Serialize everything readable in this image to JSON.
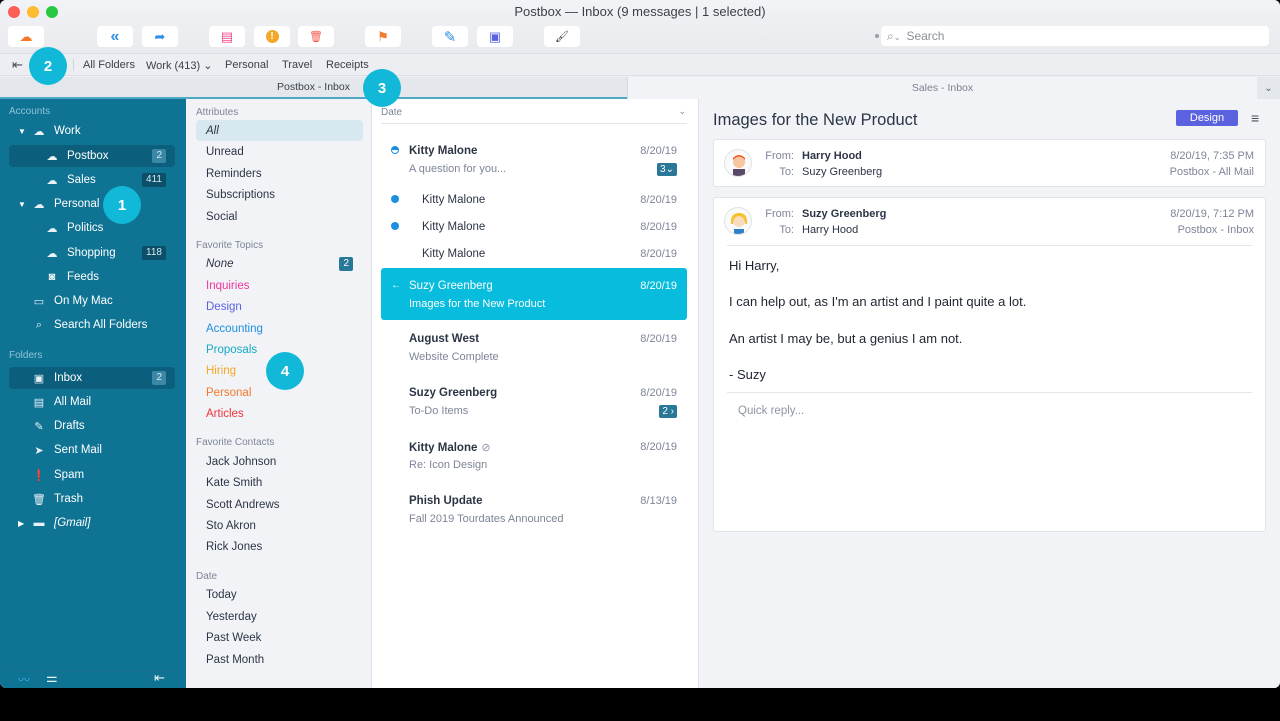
{
  "window": {
    "title": "Postbox — Inbox (9 messages | 1 selected)"
  },
  "toolbar": {
    "buttons": [
      {
        "name": "get-mail",
        "icon": "cloud-upload-icon",
        "glyph": "☁",
        "color": "#f27a2a"
      },
      {
        "name": "reply-all",
        "icon": "reply-all-icon",
        "glyph": "«",
        "color": "#2e8fe4"
      },
      {
        "name": "forward",
        "icon": "forward-icon",
        "glyph": "➦",
        "color": "#2e8fe4"
      },
      {
        "name": "archive",
        "icon": "archive-icon",
        "glyph": "▤",
        "color": "#f0498d"
      },
      {
        "name": "junk",
        "icon": "alert-icon",
        "glyph": "!",
        "color": "#f3a82a"
      },
      {
        "name": "delete",
        "icon": "trash-icon",
        "glyph": "🗑",
        "color": "#f25a4a"
      },
      {
        "name": "flag",
        "icon": "flag-icon",
        "glyph": "⚑",
        "color": "#f27a2a"
      },
      {
        "name": "compose",
        "icon": "pencil-icon",
        "glyph": "✎",
        "color": "#2e8fe4"
      },
      {
        "name": "address-book",
        "icon": "contacts-icon",
        "glyph": "▣",
        "color": "#5b62e0"
      },
      {
        "name": "themes",
        "icon": "brush-icon",
        "glyph": "🖌",
        "color": "#3b3f47"
      }
    ],
    "search": {
      "placeholder": "Search",
      "value": "",
      "icon": "search-icon"
    }
  },
  "favorites_bar": {
    "items": [
      "All Folders",
      "Work (413)",
      "Personal",
      "Travel",
      "Receipts"
    ],
    "dropdown_glyph": "⌄"
  },
  "tabs": [
    {
      "label": "Postbox - Inbox",
      "active": true
    },
    {
      "label": "Sales - Inbox",
      "active": false
    }
  ],
  "sidebar": {
    "accounts_label": "Accounts",
    "accounts": [
      {
        "label": "Work",
        "icon": "cloud-icon",
        "expanded": true,
        "level": 0
      },
      {
        "label": "Postbox",
        "icon": "cloud-icon",
        "badge": "2",
        "selected": true,
        "level": 1
      },
      {
        "label": "Sales",
        "icon": "cloud-icon",
        "badge": "411",
        "level": 1
      },
      {
        "label": "Personal",
        "icon": "cloud-icon",
        "expanded": true,
        "level": 0
      },
      {
        "label": "Politics",
        "icon": "cloud-icon",
        "level": 1
      },
      {
        "label": "Shopping",
        "icon": "cloud-icon",
        "badge": "118",
        "level": 1
      },
      {
        "label": "Feeds",
        "icon": "rss-icon",
        "level": 1
      },
      {
        "label": "On My Mac",
        "icon": "monitor-icon",
        "level": 0
      },
      {
        "label": "Search All Folders",
        "icon": "search-icon",
        "level": 0
      }
    ],
    "folders_label": "Folders",
    "folders": [
      {
        "label": "Inbox",
        "icon": "inbox-icon",
        "badge": "2",
        "selected": true
      },
      {
        "label": "All Mail",
        "icon": "archive-icon"
      },
      {
        "label": "Drafts",
        "icon": "pencil-icon"
      },
      {
        "label": "Sent Mail",
        "icon": "send-icon"
      },
      {
        "label": "Spam",
        "icon": "alert-icon"
      },
      {
        "label": "Trash",
        "icon": "trash-icon"
      },
      {
        "label": "[Gmail]",
        "icon": "folder-icon",
        "collapsed": true
      }
    ]
  },
  "attributes": {
    "attributes_label": "Attributes",
    "attributes": [
      "All",
      "Unread",
      "Reminders",
      "Subscriptions",
      "Social"
    ],
    "topics_label": "Favorite Topics",
    "topics": [
      {
        "label": "None",
        "badge": "2",
        "color": "#2c3545"
      },
      {
        "label": "Inquiries",
        "color": "#f0359a"
      },
      {
        "label": "Design",
        "color": "#5b62e0"
      },
      {
        "label": "Accounting",
        "color": "#1d8fe0"
      },
      {
        "label": "Proposals",
        "color": "#15a9c4"
      },
      {
        "label": "Hiring",
        "color": "#f6a623"
      },
      {
        "label": "Personal",
        "color": "#f5782a"
      },
      {
        "label": "Articles",
        "color": "#f2353a"
      }
    ],
    "contacts_label": "Favorite Contacts",
    "contacts": [
      "Jack Johnson",
      "Kate Smith",
      "Scott Andrews",
      "Sto Akron",
      "Rick Jones"
    ],
    "date_label": "Date",
    "dates": [
      "Today",
      "Yesterday",
      "Past Week",
      "Past Month"
    ]
  },
  "message_list": {
    "sort_label": "Date",
    "messages": [
      {
        "from": "Kitty Malone",
        "subject": "A question for you...",
        "date": "8/20/19",
        "status": "partially-unread",
        "thread_count": "3⌄"
      },
      {
        "from": "Kitty Malone",
        "date": "8/20/19",
        "status": "unread",
        "child": true
      },
      {
        "from": "Kitty Malone",
        "date": "8/20/19",
        "status": "unread",
        "child": true
      },
      {
        "from": "Kitty Malone",
        "date": "8/20/19",
        "status": "read",
        "child": true
      },
      {
        "from": "Suzy Greenberg",
        "subject": "Images for the New Product",
        "date": "8/20/19",
        "status": "replied",
        "selected": true
      },
      {
        "from": "August West",
        "subject": "Website Complete",
        "date": "8/20/19"
      },
      {
        "from": "Suzy Greenberg",
        "subject": "To-Do Items",
        "date": "8/20/19",
        "thread_count": "2 ›"
      },
      {
        "from": "Kitty Malone",
        "subject": "Re: Icon Design",
        "date": "8/20/19",
        "attachment": true
      },
      {
        "from": "Phish Update",
        "subject": "Fall 2019 Tourdates Announced",
        "date": "8/13/19"
      }
    ]
  },
  "reader": {
    "title": "Images for the New Product",
    "tag": {
      "label": "Design",
      "color": "#5b62e0"
    },
    "from_label": "From:",
    "to_label": "To:",
    "messages": [
      {
        "from": "Harry Hood",
        "to": "Suzy Greenberg",
        "datetime": "8/20/19, 7:35 PM",
        "folder": "Postbox - All Mail",
        "collapsed": true
      },
      {
        "from": "Suzy Greenberg",
        "to": "Harry Hood",
        "datetime": "8/20/19, 7:12 PM",
        "folder": "Postbox - Inbox",
        "body": [
          "Hi Harry,",
          "I can help out, as I'm an artist and I paint quite a lot.",
          "An artist I may be, but a genius I am not.",
          "- Suzy"
        ]
      }
    ],
    "quick_reply_placeholder": "Quick reply..."
  },
  "callouts": [
    "1",
    "2",
    "3",
    "4"
  ]
}
